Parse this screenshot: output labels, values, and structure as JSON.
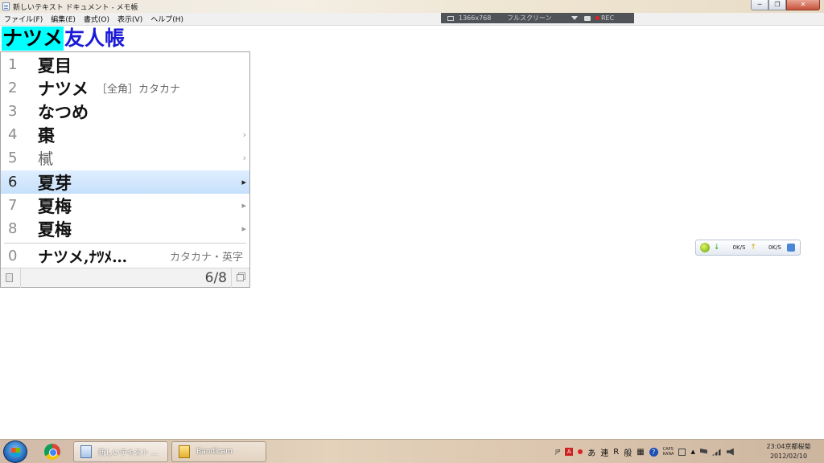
{
  "window": {
    "title": "新しいテキスト ドキュメント - メモ帳",
    "controls": {
      "minimize": "─",
      "maximize": "❐",
      "close": "✕"
    }
  },
  "menu": [
    "ファイル(F)",
    "編集(E)",
    "書式(O)",
    "表示(V)",
    "ヘルプ(H)"
  ],
  "recorder": {
    "resolution": "1366x768",
    "mode": "フルスクリーン",
    "rec_label": "REC"
  },
  "editor": {
    "composition_selected": "ナツメ",
    "composition_rest": "友人帳"
  },
  "ime": {
    "candidates": [
      {
        "num": "1",
        "word": "夏目",
        "note": "",
        "arrow": ""
      },
      {
        "num": "2",
        "word": "ナツメ",
        "note": "［全角］カタカナ",
        "arrow": ""
      },
      {
        "num": "3",
        "word": "なつめ",
        "note": "",
        "arrow": ""
      },
      {
        "num": "4",
        "word": "棗",
        "note": "",
        "arrow": "›"
      },
      {
        "num": "5",
        "word": "樲",
        "note": "",
        "arrow": "›"
      },
      {
        "num": "6",
        "word": "夏芽",
        "note": "",
        "arrow": "▸"
      },
      {
        "num": "7",
        "word": "夏梅",
        "note": "",
        "arrow": "▸"
      },
      {
        "num": "8",
        "word": "夏梅",
        "note": "",
        "arrow": "▸"
      }
    ],
    "selected_index": 6,
    "last": {
      "num": "0",
      "word": "ナツメ,ﾅﾂﾒ…",
      "note": "カタカナ・英字"
    },
    "page": "6/8"
  },
  "netmon": {
    "down_arrow": "↓",
    "down": "0K/S",
    "up_arrow": "↑",
    "up": "0K/S"
  },
  "taskbar": {
    "tasks": [
      {
        "label": "新しいテキスト ..."
      },
      {
        "label": "Bandicam"
      }
    ],
    "tray": {
      "lang": "JP",
      "ime_a": "A",
      "kana": "あ",
      "ren": "連",
      "r": "R",
      "han": "般",
      "grid": "▦",
      "help": "?",
      "caps": "CAPS",
      "kana_lock": "KANA",
      "up": "▲"
    },
    "clock_time": "23:04",
    "clock_place": "京都桜菊",
    "clock_date": "2012/02/10"
  }
}
